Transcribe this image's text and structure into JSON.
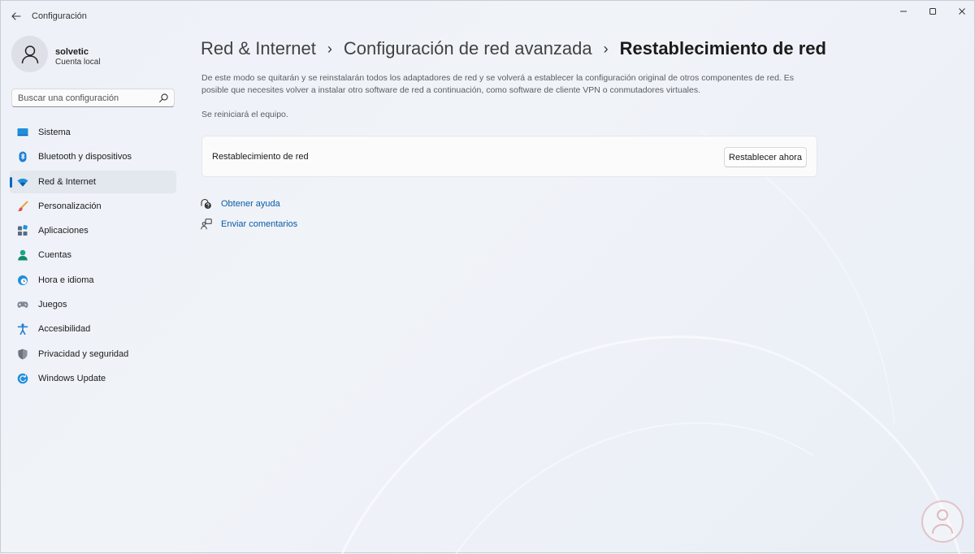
{
  "titlebar": {
    "app_title": "Configuración"
  },
  "user": {
    "name": "solvetic",
    "account_type": "Cuenta local"
  },
  "search": {
    "placeholder": "Buscar una configuración"
  },
  "nav": {
    "items": [
      {
        "label": "Sistema",
        "icon": "monitor-icon",
        "active": false
      },
      {
        "label": "Bluetooth y dispositivos",
        "icon": "bluetooth-icon",
        "active": false
      },
      {
        "label": "Red & Internet",
        "icon": "wifi-icon",
        "active": true
      },
      {
        "label": "Personalización",
        "icon": "brush-icon",
        "active": false
      },
      {
        "label": "Aplicaciones",
        "icon": "apps-icon",
        "active": false
      },
      {
        "label": "Cuentas",
        "icon": "person-icon",
        "active": false
      },
      {
        "label": "Hora e idioma",
        "icon": "clock-globe-icon",
        "active": false
      },
      {
        "label": "Juegos",
        "icon": "gamepad-icon",
        "active": false
      },
      {
        "label": "Accesibilidad",
        "icon": "accessibility-icon",
        "active": false
      },
      {
        "label": "Privacidad y seguridad",
        "icon": "shield-icon",
        "active": false
      },
      {
        "label": "Windows Update",
        "icon": "update-icon",
        "active": false
      }
    ]
  },
  "breadcrumb": {
    "items": [
      "Red & Internet",
      "Configuración de red avanzada",
      "Restablecimiento de red"
    ],
    "separator": "›"
  },
  "main": {
    "description": "De este modo se quitarán y se reinstalarán todos los adaptadores de red y se volverá a establecer la configuración original de otros componentes de red. Es posible que necesites volver a instalar otro software de red a continuación, como software de cliente VPN o conmutadores virtuales.",
    "restart_note": "Se reiniciará el equipo.",
    "card": {
      "label": "Restablecimiento de red",
      "button_label": "Restablecer ahora"
    },
    "links": [
      {
        "label": "Obtener ayuda",
        "icon": "help-icon"
      },
      {
        "label": "Enviar comentarios",
        "icon": "feedback-icon"
      }
    ]
  },
  "colors": {
    "accent": "#0067c0",
    "link": "#0b5aa6",
    "background": "#eef2f8"
  }
}
